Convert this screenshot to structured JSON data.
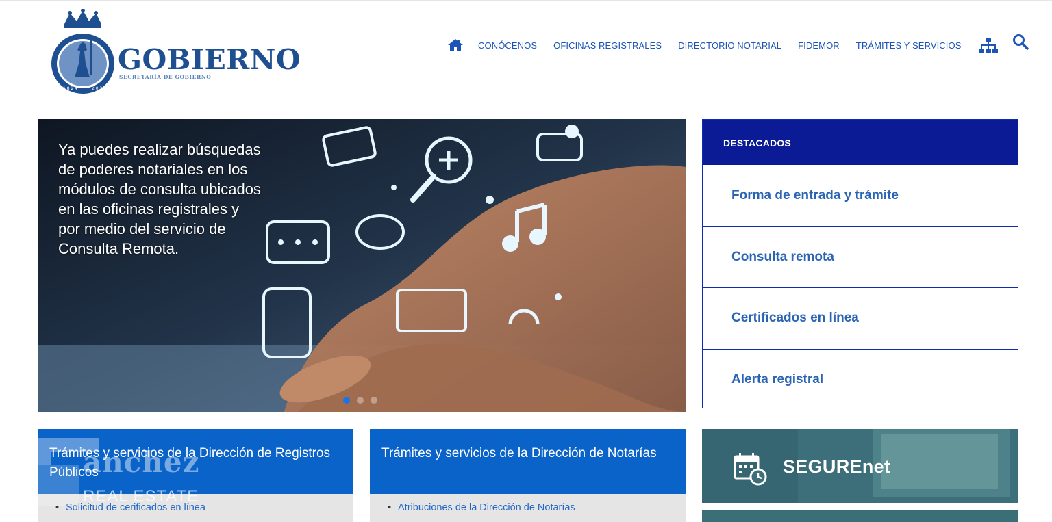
{
  "header": {
    "logo_word": "GOBIERNO",
    "logo_subtitle": "SECRETARÍA DE GOBIERNO",
    "nav": {
      "home_icon": "home-icon",
      "items": [
        "CONÓCENOS",
        "OFICINAS REGISTRALES",
        "DIRECTORIO NOTARIAL",
        "FIDEMOR",
        "TRÁMITES Y SERVICIOS"
      ],
      "sitemap_icon": "sitemap-icon",
      "search_icon": "search-icon"
    }
  },
  "hero": {
    "text": "Ya puedes realizar búsquedas de poderes notariales en los módulos de consulta ubicados en las oficinas registrales y por medio del servicio de Consulta Remota.",
    "slide_count": 3,
    "active_slide": 1
  },
  "destacados": {
    "title": "DESTACADOS",
    "items": [
      "Forma de entrada y trámite",
      "Consulta remota",
      "Certificados en línea",
      "Alerta registral"
    ]
  },
  "cards": [
    {
      "title": "Trámites y servicios de la Dirección de Registros Públicos",
      "items": [
        "Solicitud de cerificados en línea"
      ]
    },
    {
      "title": "Trámites y servicios de la Dirección de Notarías",
      "items": [
        "Atribuciones de la Dirección de Notarías"
      ]
    }
  ],
  "watermark": {
    "big": "anchez",
    "small": "REAL ESTATE"
  },
  "banner": {
    "label": "SEGUREnet",
    "icon": "calendar-clock-icon"
  },
  "colors": {
    "nav_text": "#1c55b6",
    "destacados_header": "#0b1b95",
    "card_header": "#0a63c9",
    "logo": "#1d4f91",
    "link": "#2168c6"
  }
}
